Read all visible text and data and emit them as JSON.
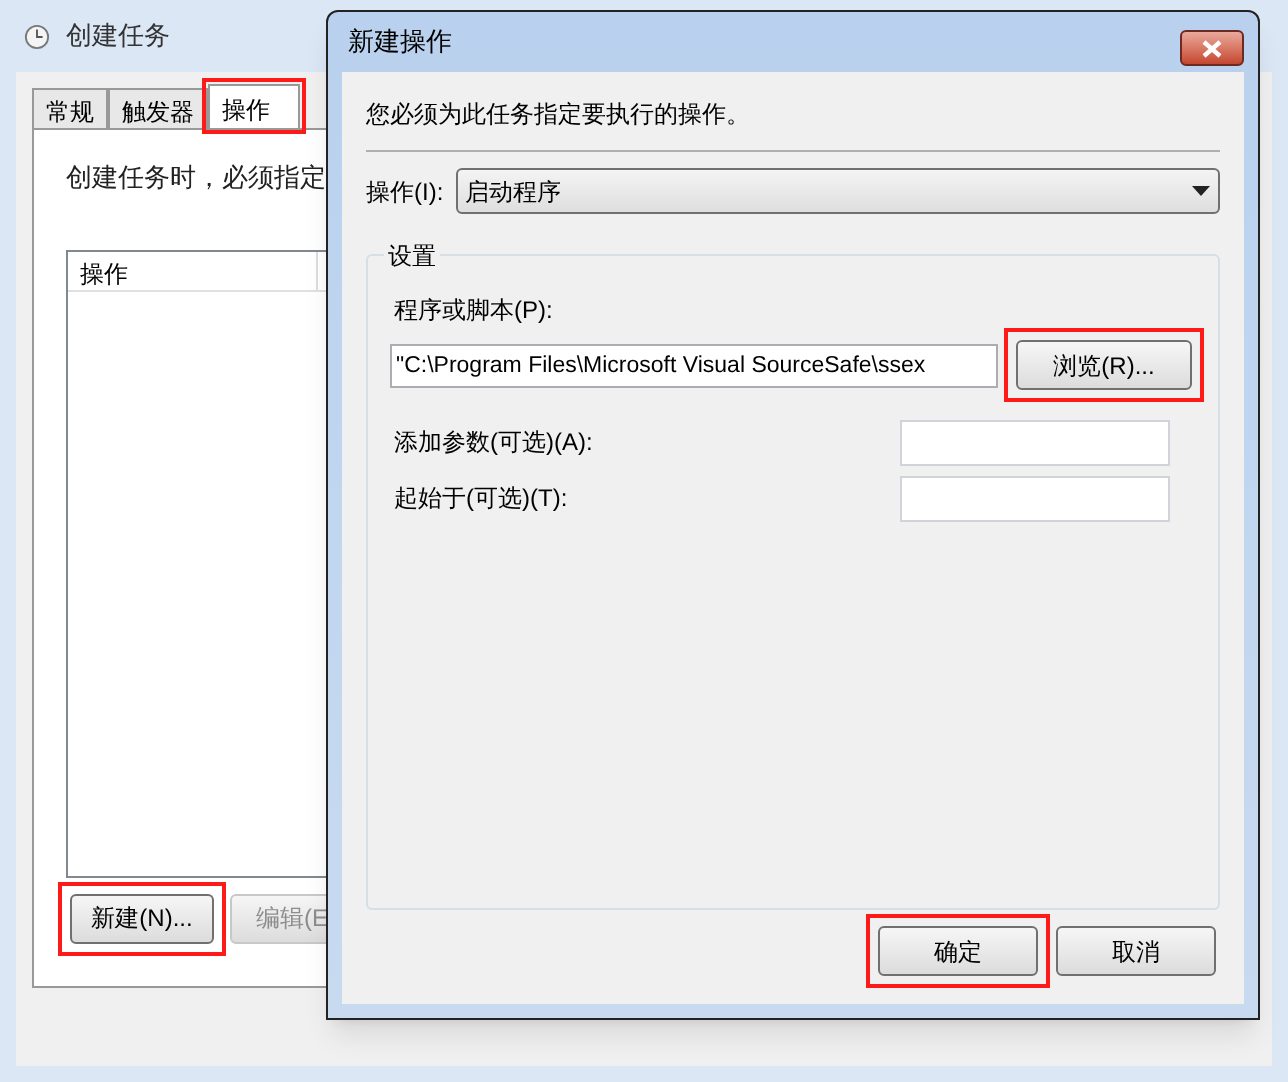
{
  "window": {
    "title": "创建任务"
  },
  "tabs": [
    {
      "label": "常规",
      "selected": false,
      "highlighted": false
    },
    {
      "label": "触发器",
      "selected": false,
      "highlighted": false
    },
    {
      "label": "操作",
      "selected": true,
      "highlighted": true
    }
  ],
  "description": "创建任务时，必须指定",
  "actions_list": {
    "columns": [
      "操作"
    ]
  },
  "list_buttons": [
    {
      "label": "新建(N)...",
      "highlighted": true,
      "disabled": false
    },
    {
      "label": "编辑(E",
      "highlighted": false,
      "disabled": true
    }
  ],
  "dialog": {
    "title": "新建操作",
    "instruction": "您必须为此任务指定要执行的操作。",
    "action": {
      "label": "操作(I):",
      "value": "启动程序"
    },
    "group": {
      "title": "设置",
      "fields": [
        {
          "kind": "wide",
          "label": "程序或脚本(P):",
          "value": "\"C:\\Program Files\\Microsoft Visual SourceSafe\\ssex"
        },
        {
          "kind": "inline",
          "label": "添加参数(可选)(A):"
        },
        {
          "kind": "inline",
          "label": "起始于(可选)(T):"
        }
      ]
    },
    "browse_button": {
      "label": "浏览(R)...",
      "highlighted": true
    },
    "buttons": [
      {
        "label": "确定",
        "highlighted": true
      },
      {
        "label": "取消",
        "highlighted": false
      }
    ]
  }
}
